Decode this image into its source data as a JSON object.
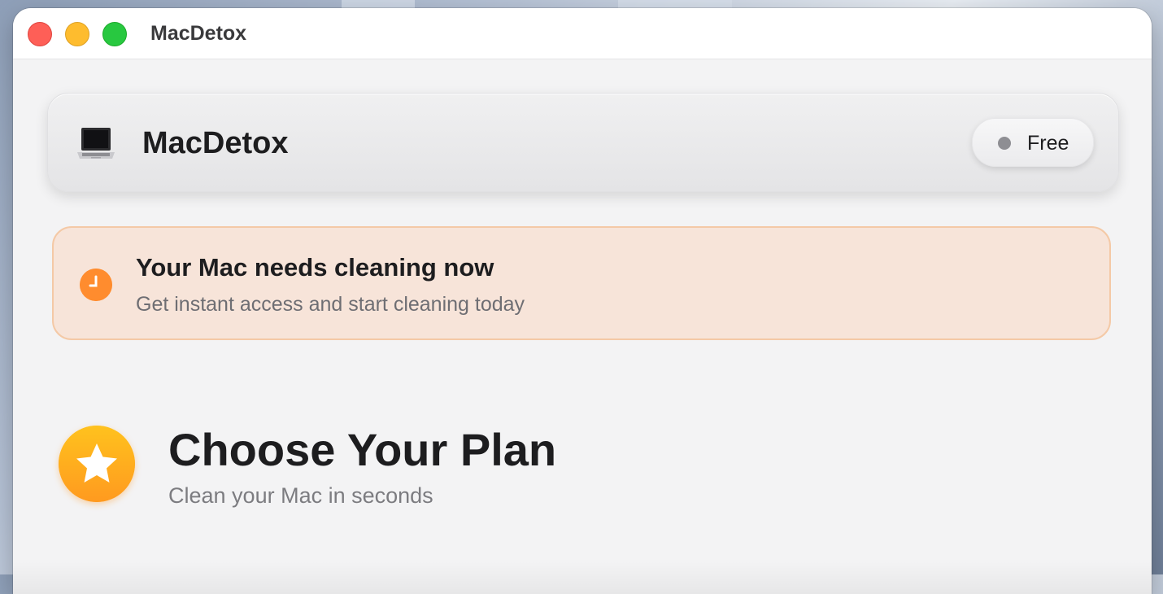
{
  "window": {
    "title": "MacDetox"
  },
  "header": {
    "icon": "laptop-icon",
    "app_name": "MacDetox",
    "plan_badge": {
      "label": "Free",
      "dot_color": "#8e8e93"
    }
  },
  "alert": {
    "icon": "clock-icon",
    "title": "Your Mac needs cleaning now",
    "subtitle": "Get instant access and start cleaning today",
    "accent_color": "#ff8c2e",
    "background_color": "#f7e4d9"
  },
  "plan": {
    "icon": "star-icon",
    "title": "Choose Your Plan",
    "subtitle": "Clean your Mac in seconds"
  }
}
